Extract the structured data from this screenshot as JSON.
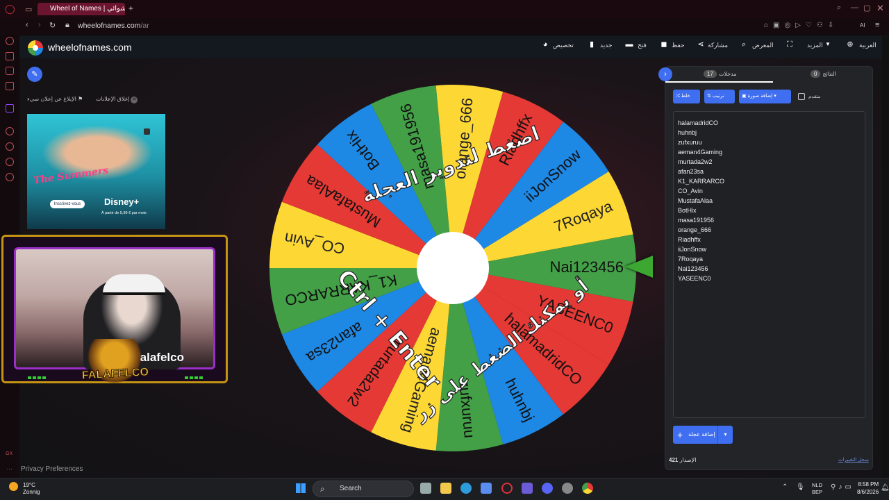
{
  "browser": {
    "tab_title": "Wheel of Names | العشوائي",
    "url_domain": "wheelofnames.com",
    "url_path": "/ar"
  },
  "header": {
    "brand": "wheelofnames.com",
    "menu": {
      "customize": "تخصيص",
      "new": "جديد",
      "open": "فتح",
      "save": "حفظ",
      "share": "مشاركة",
      "gallery": "المعرض",
      "more": "المزيد",
      "language": "العربية"
    }
  },
  "ads": {
    "close_label": "إغلاق الإعلانات",
    "report_label": "الإبلاغ عن إعلان سيء",
    "ad_title": "The Summers",
    "ad_button": "Inscrivez-vous",
    "ad_brand": "Disney+",
    "ad_price": "À partir de 5,99 € par mois"
  },
  "stream": {
    "overlay_label": "FALAFELCO",
    "shirt_text": "falafelco"
  },
  "wheel": {
    "instruction_top": "اضغط لتدوير العجلة",
    "instruction_bottom": "أو يمكنك الضغط على زر",
    "shortcut": "Ctrl + Enter",
    "colors": [
      "#e53935",
      "#1e88e5",
      "#43a047",
      "#fdd835"
    ]
  },
  "panel": {
    "tab_entries_label": "مدخلات",
    "tab_entries_count": "17",
    "tab_results_label": "النتائج",
    "tab_results_count": "0",
    "btn_shuffle": "خلط",
    "btn_sort": "ترتيب",
    "btn_add_image": "إضافة صورة",
    "advanced_label": "متقدم",
    "entries": [
      "halamadridCO",
      "huhnbj",
      "zufxuruu",
      "aeman4Gaming",
      "murtada2w2",
      "afan23sa",
      "K1_KARRARCO",
      "CO_Avin",
      "MustafaAlaa",
      "BotHix",
      "masa191956",
      "orange_666",
      "Riadhffx",
      "iiJonSnow",
      "7Roqaya",
      "Nai123456",
      "YASEENC0"
    ],
    "add_wheel": "إضافة عجلة",
    "version_label": "الإصدار",
    "version_number": "421",
    "changelog": "سجل التغييرات"
  },
  "footer": {
    "privacy": "Privacy Preferences"
  },
  "taskbar": {
    "temperature": "19°C",
    "weather": "Zonnig",
    "search": "Search",
    "lang_1": "NLD",
    "lang_2": "BEP",
    "time": "8:58 PM",
    "date": "8/6/2026"
  }
}
